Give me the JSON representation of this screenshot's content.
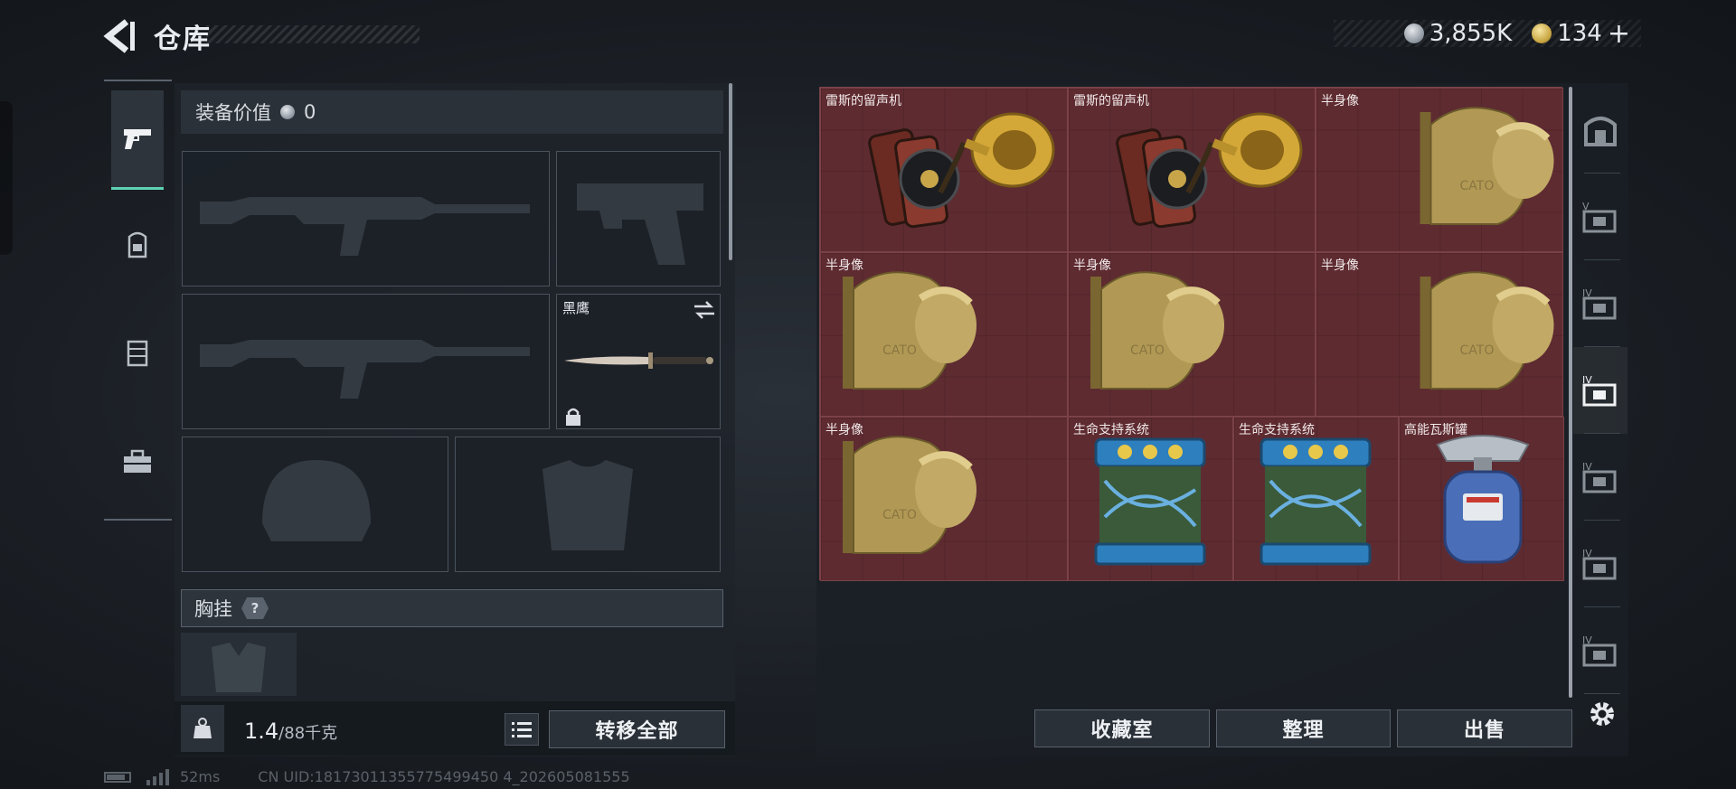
{
  "header": {
    "title": "仓库"
  },
  "currency": {
    "silver": "3,855K",
    "gold": "134",
    "plus": "+"
  },
  "nav": {
    "items": [
      "pistol-icon",
      "backpack-icon",
      "vest-icon",
      "toolbox-icon"
    ],
    "active": 0
  },
  "equipment": {
    "value_label": "装备价值",
    "value": "0",
    "knife_name": "黑鹰",
    "chest_label": "胸挂",
    "help": "?"
  },
  "weight": {
    "current": "1.4",
    "max": "/88千克"
  },
  "buttons": {
    "transfer_all": "转移全部",
    "collection": "收藏室",
    "organize": "整理",
    "sell": "出售"
  },
  "storage": {
    "items": [
      {
        "name": "雷斯的留声机",
        "icon": "gramophone"
      },
      {
        "name": "雷斯的留声机",
        "icon": "gramophone"
      },
      {
        "name": "半身像",
        "icon": "bust"
      },
      {
        "name": "半身像",
        "icon": "bust"
      },
      {
        "name": "半身像",
        "icon": "bust"
      },
      {
        "name": "半身像",
        "icon": "bust"
      },
      {
        "name": "半身像",
        "icon": "bust"
      },
      {
        "name": "生命支持系统",
        "icon": "life-support"
      },
      {
        "name": "生命支持系统",
        "icon": "life-support"
      },
      {
        "name": "高能瓦斯罐",
        "icon": "gas-can"
      }
    ],
    "bust_engraving": "CATO",
    "cell_color": "#5e2b31",
    "cell_border": "#7a4248"
  },
  "side_tabs": {
    "labels": [
      "",
      "V",
      "IV",
      "IV",
      "IV",
      "IV",
      "IV"
    ],
    "active": 3
  },
  "status": {
    "latency": "52ms",
    "uid": "CN UID:18173011355775499450 4_202605081555"
  },
  "colors": {
    "accent": "#5ed3b4"
  }
}
